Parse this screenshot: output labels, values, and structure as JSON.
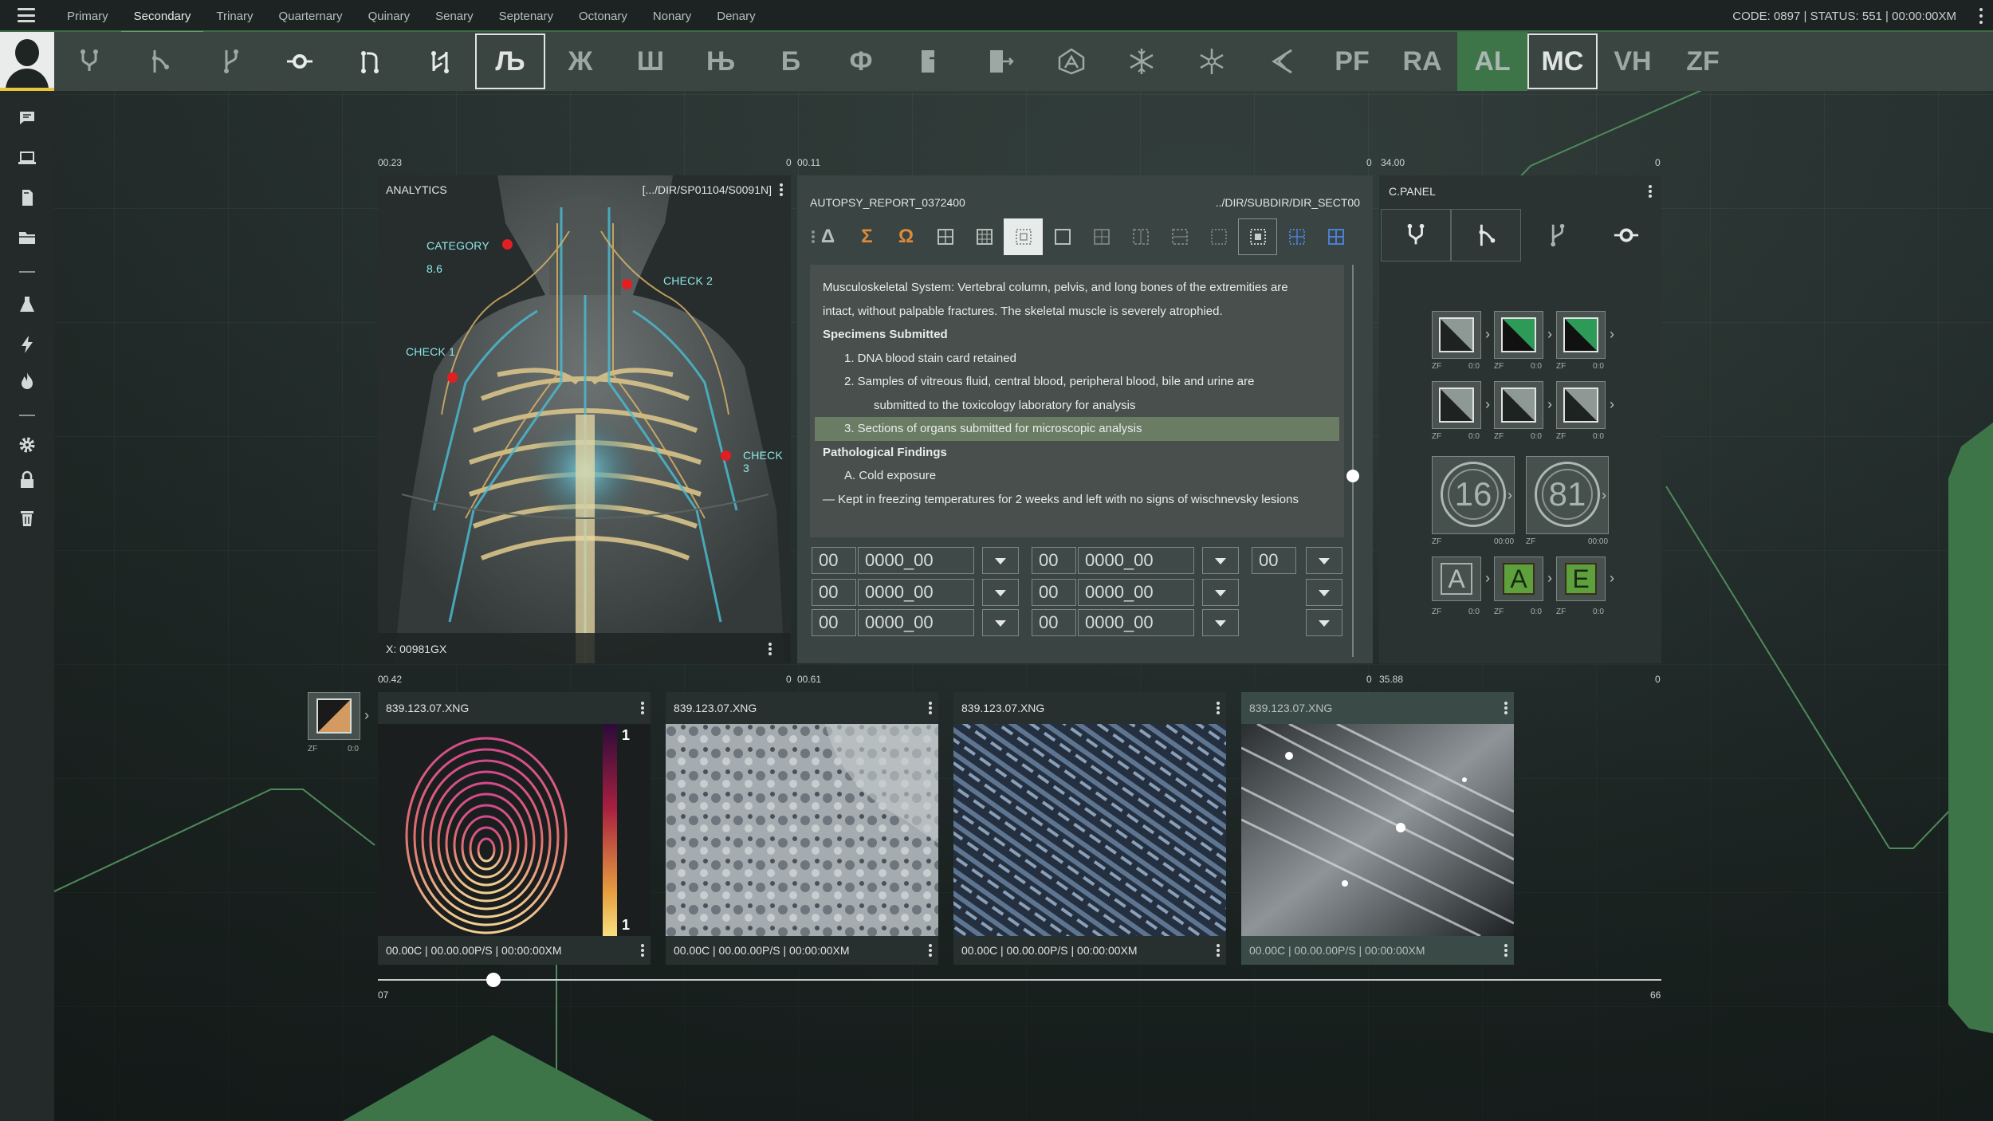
{
  "top_menu": {
    "items": [
      "Primary",
      "Secondary",
      "Trinary",
      "Quarternary",
      "Quinary",
      "Senary",
      "Septenary",
      "Octonary",
      "Nonary",
      "Denary"
    ],
    "active": "Secondary",
    "status": "CODE: 0897 | STATUS: 551 | 00:00:00XM"
  },
  "sidebar_icons": [
    "chat-icon",
    "laptop-icon",
    "document-icon",
    "folder-icon",
    "flask-icon",
    "lightning-icon",
    "fire-icon",
    "gear-icon",
    "lock-icon",
    "trash-icon"
  ],
  "toolbar": {
    "glyphs": [
      "Љ",
      "Ж",
      "Ш",
      "Њ",
      "Б",
      "Ф"
    ],
    "abbr": [
      "PF",
      "RA",
      "AL",
      "MC",
      "VH",
      "ZF"
    ]
  },
  "panel_labels": {
    "analytics_left": "00.23",
    "analytics_right": "0",
    "report_left": "00.11",
    "report_right": "0",
    "cpanel_left": "34.00",
    "cpanel_right": "0",
    "thumbs_a_left": "00.42",
    "thumbs_a_right": "0",
    "thumbs_b_left": "00.61",
    "thumbs_b_right": "0",
    "thumbs_c_left": "35.88",
    "thumbs_c_right": "0"
  },
  "analytics": {
    "title": "ANALYTICS",
    "path": "[.../DIR/SP01104/S0091N]",
    "annotations": {
      "category": "CATEGORY",
      "category_value": "8.6",
      "check1": "CHECK 1",
      "check2": "CHECK 2",
      "check3": "CHECK 3"
    },
    "coord": "X: 00981GX"
  },
  "report": {
    "title": "AUTOPSY_REPORT_0372400",
    "path": "../DIR/SUBDIR/DIR_SECT00",
    "tools": [
      "Δ",
      "Σ",
      "Ω"
    ],
    "lines": [
      {
        "text": "Musculoskeletal System: Vertebral column, pelvis, and long bones of the extremities are",
        "style": "normal"
      },
      {
        "text": "intact, without palpable fractures. The skeletal muscle is severely atrophied.",
        "style": "normal"
      },
      {
        "text": "Specimens Submitted",
        "style": "bold"
      },
      {
        "text": "1. DNA blood stain card retained",
        "style": "ind1"
      },
      {
        "text": "2. Samples of vitreous fluid, central blood, peripheral blood, bile and urine are",
        "style": "ind1"
      },
      {
        "text": "submitted to the toxicology laboratory for analysis",
        "style": "ind2"
      },
      {
        "text": "3. Sections of organs submitted for microscopic analysis",
        "style": "highlight"
      },
      {
        "text": "Pathological Findings",
        "style": "bold"
      },
      {
        "text": "A. Cold exposure",
        "style": "ind1"
      },
      {
        "text": "— Kept in freezing temperatures for 2 weeks and left with no signs of wischnevsky lesions",
        "style": "normal"
      }
    ],
    "fields": {
      "short": "00",
      "long": "0000_00"
    }
  },
  "cpanel": {
    "title": "C.PANEL",
    "tile_caption": "ZF",
    "tile_value": "0:0",
    "ring_values": [
      "16",
      "81"
    ],
    "ring_time": "00:00",
    "letters": [
      "A",
      "A",
      "E"
    ]
  },
  "thumbnails": [
    {
      "name": "839.123.07.XNG",
      "footer": "00.00C | 00.00.00P/S | 00:00:00XM",
      "scale_top": "1",
      "scale_bottom": "1"
    },
    {
      "name": "839.123.07.XNG",
      "footer": "00.00C | 00.00.00P/S | 00:00:00XM"
    },
    {
      "name": "839.123.07.XNG",
      "footer": "00.00C | 00.00.00P/S | 00:00:00XM"
    },
    {
      "name": "839.123.07.XNG",
      "footer": "00.00C | 00.00.00P/S | 00:00:00XM"
    }
  ],
  "mini_tile": {
    "caption": "ZF",
    "value": "0:0"
  },
  "timeline": {
    "start": "07",
    "end": "66",
    "position": 0.09
  },
  "colors": {
    "accent_green": "#5ea06a",
    "highlight": "#6a7c64",
    "check_dot": "#e21e22",
    "annotation": "#8fe7ea"
  }
}
